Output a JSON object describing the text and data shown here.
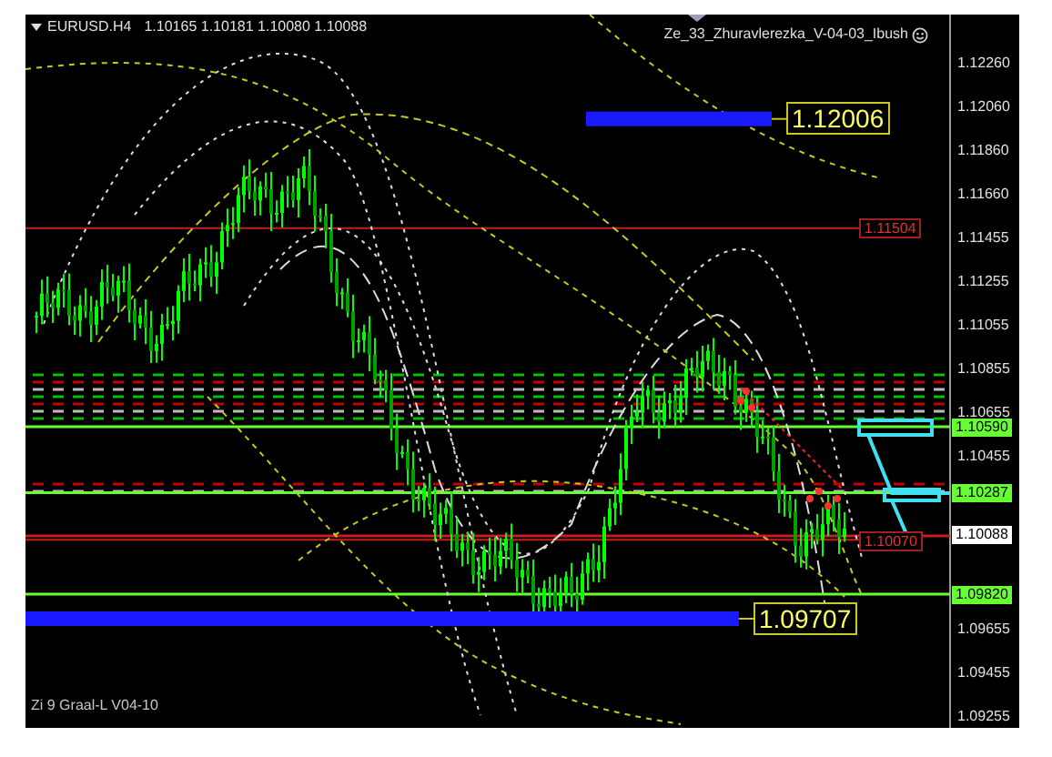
{
  "header": {
    "symbol": "EURUSD.H4",
    "quote": "1.10165 1.10181 1.10080 1.10088"
  },
  "indicator": "Ze_33_Zhuravlerezka_V-04-03_Ibush",
  "price_axis": [
    {
      "text": "1.12260"
    },
    {
      "text": "1.12060"
    },
    {
      "text": "1.11860"
    },
    {
      "text": "1.11660"
    },
    {
      "text": "1.11455"
    },
    {
      "text": "1.11255"
    },
    {
      "text": "1.11055"
    },
    {
      "text": "1.10855"
    },
    {
      "text": "1.10655"
    },
    {
      "text": "1.10455"
    },
    {
      "text": "1.09655"
    },
    {
      "text": "1.09455"
    },
    {
      "text": "1.09255"
    }
  ],
  "axis_markers": [
    {
      "text": "1.10590",
      "color": "#66ff33"
    },
    {
      "text": "1.10287",
      "color": "#66ff33"
    },
    {
      "text": "1.10088",
      "color": "#ffffff"
    },
    {
      "text": "1.09820",
      "color": "#66ff33"
    }
  ],
  "line_labels": [
    {
      "text": "1.11504"
    },
    {
      "text": "1.10070"
    }
  ],
  "targets": [
    {
      "text": "1.12006"
    },
    {
      "text": "1.09707"
    }
  ],
  "footer": "Zi 9 Graal-L V04-10"
}
